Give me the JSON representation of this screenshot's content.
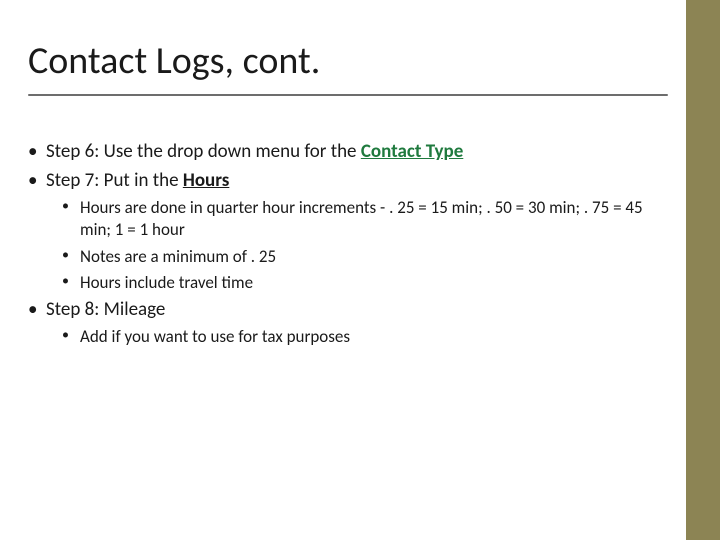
{
  "title": "Contact Logs, cont.",
  "step6": {
    "prefix": "Step 6: Use the drop down menu for the ",
    "link": "Contact Type"
  },
  "step7": {
    "prefix": "Step 7: Put in the ",
    "link": "Hours",
    "sub1": "Hours are done in quarter hour increments - . 25 = 15 min; . 50 = 30 min;  . 75 = 45 min; 1 = 1 hour",
    "sub2": "Notes are a minimum of . 25",
    "sub3": "Hours include travel time"
  },
  "step8": {
    "line": "Step 8: Mileage",
    "sub1": "Add if you want to use for tax purposes"
  },
  "bullet": "•"
}
